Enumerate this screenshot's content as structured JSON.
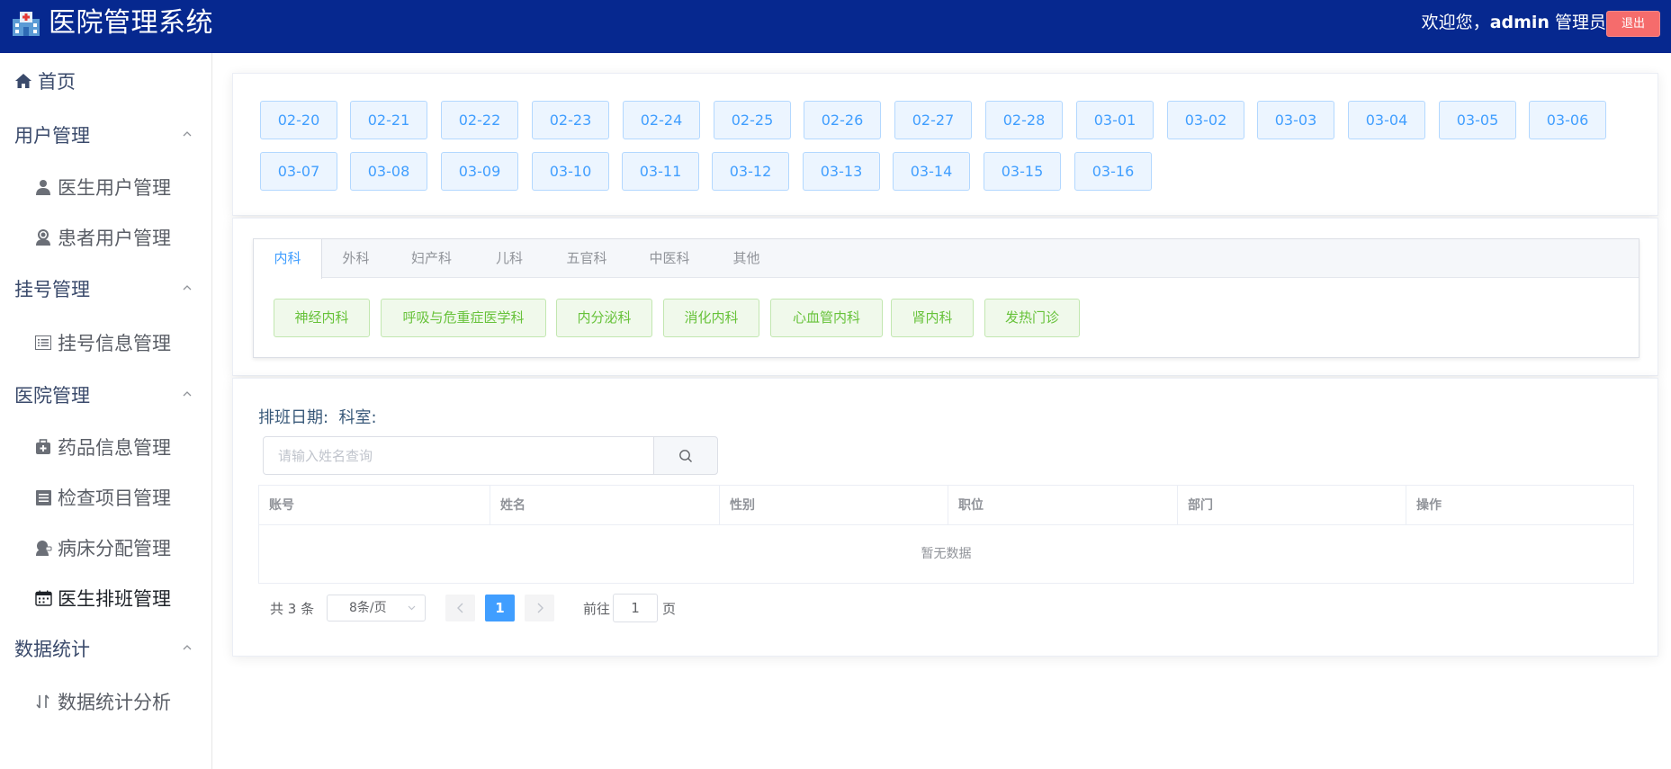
{
  "header": {
    "title": "医院管理系统",
    "welcome_prefix": "欢迎您，",
    "username": "admin",
    "role": " 管理员",
    "logout_label": "退出"
  },
  "sidebar": {
    "home": "首页",
    "groups": [
      {
        "label": "用户管理",
        "items": [
          "医生用户管理",
          "患者用户管理"
        ]
      },
      {
        "label": "挂号管理",
        "items": [
          "挂号信息管理"
        ]
      },
      {
        "label": "医院管理",
        "items": [
          "药品信息管理",
          "检查项目管理",
          "病床分配管理",
          "医生排班管理"
        ]
      },
      {
        "label": "数据统计",
        "items": [
          "数据统计分析"
        ]
      }
    ]
  },
  "dates": [
    "02-20",
    "02-21",
    "02-22",
    "02-23",
    "02-24",
    "02-25",
    "02-26",
    "02-27",
    "02-28",
    "03-01",
    "03-02",
    "03-03",
    "03-04",
    "03-05",
    "03-06",
    "03-07",
    "03-08",
    "03-09",
    "03-10",
    "03-11",
    "03-12",
    "03-13",
    "03-14",
    "03-15",
    "03-16"
  ],
  "tabs": [
    "内科",
    "外科",
    "妇产科",
    "儿科",
    "五官科",
    "中医科",
    "其他"
  ],
  "departments": [
    "神经内科",
    "呼吸与危重症医学科",
    "内分泌科",
    "消化内科",
    "心血管内科",
    "肾内科",
    "发热门诊"
  ],
  "filter": {
    "date_label": "排班日期:",
    "dept_label": "科室:",
    "search_placeholder": "请输入姓名查询"
  },
  "table": {
    "columns": [
      "账号",
      "姓名",
      "性别",
      "职位",
      "部门",
      "操作"
    ],
    "empty_text": "暂无数据"
  },
  "pagination": {
    "total_text": "共 3 条",
    "page_size": "8条/页",
    "current_page": "1",
    "goto_prefix": "前往",
    "goto_value": "1",
    "goto_suffix": "页"
  }
}
